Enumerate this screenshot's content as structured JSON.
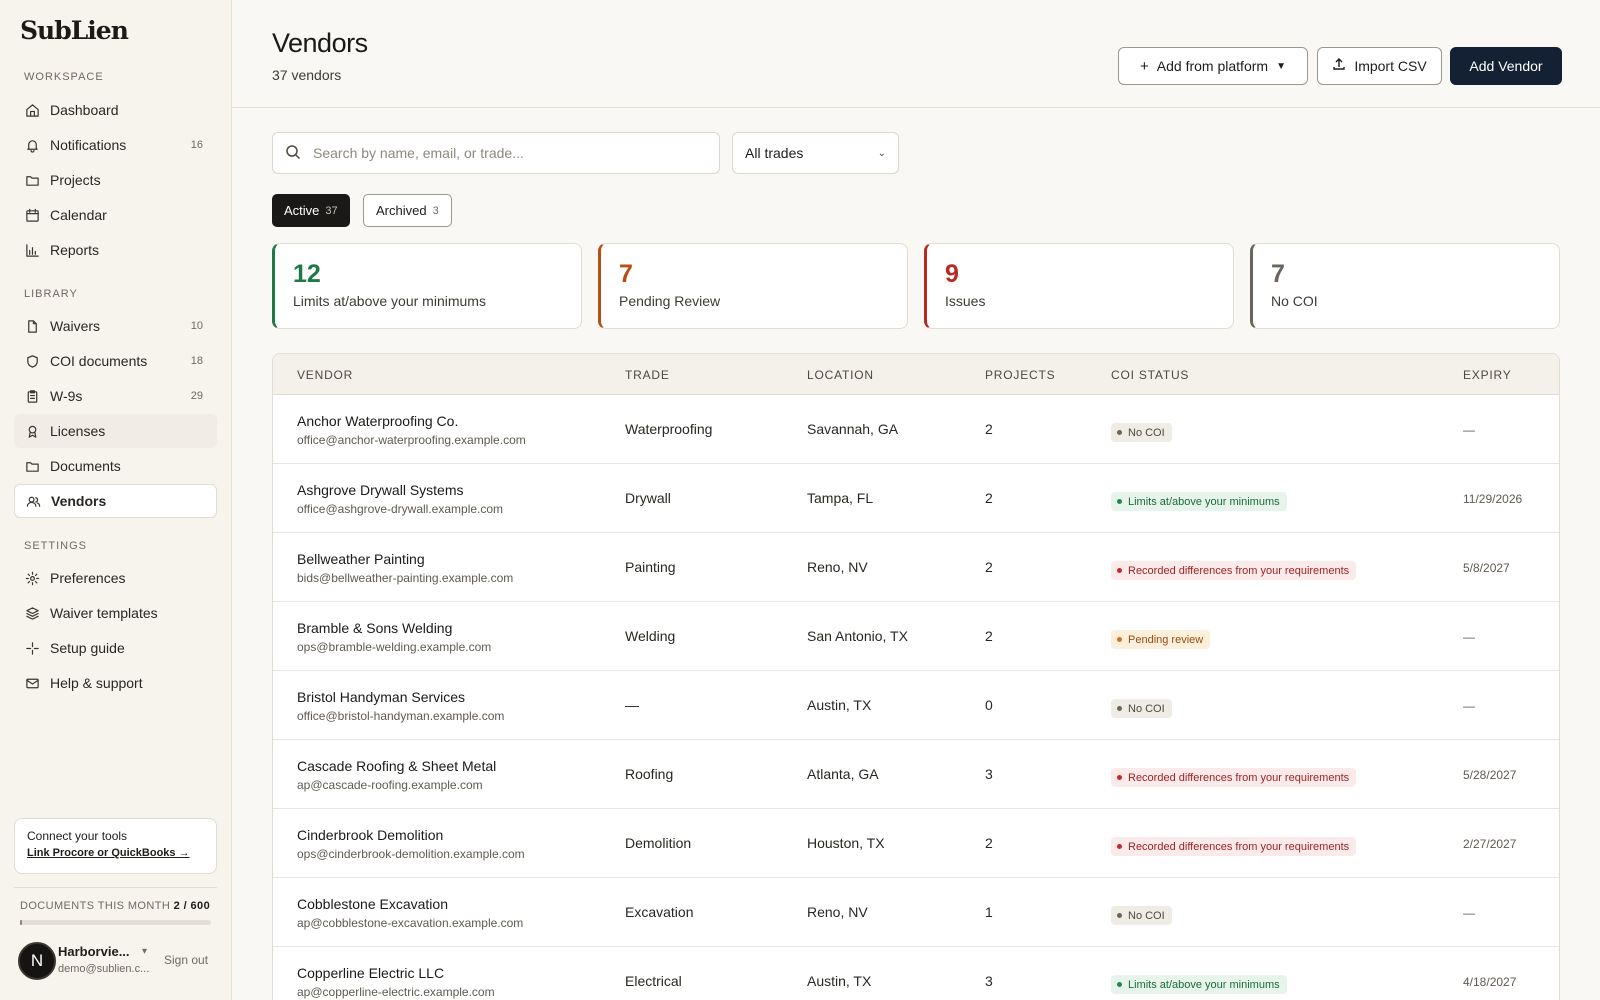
{
  "app": {
    "logo": "SubLien"
  },
  "sidebar": {
    "workspace_label": "WORKSPACE",
    "library_label": "LIBRARY",
    "settings_label": "SETTINGS",
    "workspace": [
      {
        "label": "Dashboard",
        "icon": "home-icon"
      },
      {
        "label": "Notifications",
        "count": "16",
        "icon": "bell-icon"
      },
      {
        "label": "Projects",
        "icon": "folder-icon"
      },
      {
        "label": "Calendar",
        "icon": "calendar-icon"
      },
      {
        "label": "Reports",
        "icon": "bar-chart-icon"
      }
    ],
    "library": [
      {
        "label": "Waivers",
        "count": "10",
        "icon": "file-icon"
      },
      {
        "label": "COI documents",
        "count": "18",
        "icon": "shield-icon"
      },
      {
        "label": "W-9s",
        "count": "29",
        "icon": "clipboard-icon"
      },
      {
        "label": "Licenses",
        "icon": "badge-icon"
      },
      {
        "label": "Documents",
        "icon": "folder-icon"
      },
      {
        "label": "Vendors",
        "icon": "users-icon",
        "active": true
      }
    ],
    "settings": [
      {
        "label": "Preferences",
        "icon": "gear-icon"
      },
      {
        "label": "Waiver templates",
        "icon": "layers-icon"
      },
      {
        "label": "Setup guide",
        "icon": "sparkle-icon"
      },
      {
        "label": "Help & support",
        "icon": "mail-icon"
      }
    ],
    "connect": {
      "title": "Connect your tools",
      "link": "Link Procore or QuickBooks →"
    },
    "usage": {
      "label": "DOCUMENTS THIS MONTH",
      "count": "2 / 600",
      "fraction": 0.003
    },
    "account": {
      "initial": "N",
      "name": "Harborvie...",
      "email": "demo@sublien.c...",
      "signout": "Sign out"
    }
  },
  "header": {
    "title": "Vendors",
    "subtitle": "37 vendors",
    "add_platform": "Add from platform",
    "import_csv": "Import CSV",
    "add_vendor": "Add Vendor"
  },
  "filters": {
    "search_placeholder": "Search by name, email, or trade...",
    "trade_select": "All trades"
  },
  "tabs": [
    {
      "label": "Active",
      "count": "37"
    },
    {
      "label": "Archived",
      "count": "3"
    }
  ],
  "stats": [
    {
      "value": "12",
      "label": "Limits at/above your minimums",
      "color": "#1d7a45"
    },
    {
      "value": "7",
      "label": "Pending Review",
      "color": "#b84e16"
    },
    {
      "value": "9",
      "label": "Issues",
      "color": "#b62a24"
    },
    {
      "value": "7",
      "label": "No COI",
      "color": "#6a655c"
    }
  ],
  "table": {
    "columns": [
      "VENDOR",
      "TRADE",
      "LOCATION",
      "PROJECTS",
      "COI STATUS",
      "EXPIRY"
    ],
    "rows": [
      {
        "name": "Anchor Waterproofing Co.",
        "email": "office@anchor-waterproofing.example.com",
        "trade": "Waterproofing",
        "location": "Savannah, GA",
        "projects": "2",
        "status": "No COI",
        "status_kind": "grey",
        "expiry": "—"
      },
      {
        "name": "Ashgrove Drywall Systems",
        "email": "office@ashgrove-drywall.example.com",
        "trade": "Drywall",
        "location": "Tampa, FL",
        "projects": "2",
        "status": "Limits at/above your minimums",
        "status_kind": "green",
        "expiry": "11/29/2026"
      },
      {
        "name": "Bellweather Painting",
        "email": "bids@bellweather-painting.example.com",
        "trade": "Painting",
        "location": "Reno, NV",
        "projects": "2",
        "status": "Recorded differences from your requirements",
        "status_kind": "red",
        "expiry": "5/8/2027"
      },
      {
        "name": "Bramble & Sons Welding",
        "email": "ops@bramble-welding.example.com",
        "trade": "Welding",
        "location": "San Antonio, TX",
        "projects": "2",
        "status": "Pending review",
        "status_kind": "orange",
        "expiry": "—"
      },
      {
        "name": "Bristol Handyman Services",
        "email": "office@bristol-handyman.example.com",
        "trade": "—",
        "location": "Austin, TX",
        "projects": "0",
        "status": "No COI",
        "status_kind": "grey",
        "expiry": "—"
      },
      {
        "name": "Cascade Roofing & Sheet Metal",
        "email": "ap@cascade-roofing.example.com",
        "trade": "Roofing",
        "location": "Atlanta, GA",
        "projects": "3",
        "status": "Recorded differences from your requirements",
        "status_kind": "red",
        "expiry": "5/28/2027"
      },
      {
        "name": "Cinderbrook Demolition",
        "email": "ops@cinderbrook-demolition.example.com",
        "trade": "Demolition",
        "location": "Houston, TX",
        "projects": "2",
        "status": "Recorded differences from your requirements",
        "status_kind": "red",
        "expiry": "2/27/2027"
      },
      {
        "name": "Cobblestone Excavation",
        "email": "ap@cobblestone-excavation.example.com",
        "trade": "Excavation",
        "location": "Reno, NV",
        "projects": "1",
        "status": "No COI",
        "status_kind": "grey",
        "expiry": "—"
      },
      {
        "name": "Copperline Electric LLC",
        "email": "ap@copperline-electric.example.com",
        "trade": "Electrical",
        "location": "Austin, TX",
        "projects": "3",
        "status": "Limits at/above your minimums",
        "status_kind": "green",
        "expiry": "4/18/2027"
      }
    ]
  }
}
